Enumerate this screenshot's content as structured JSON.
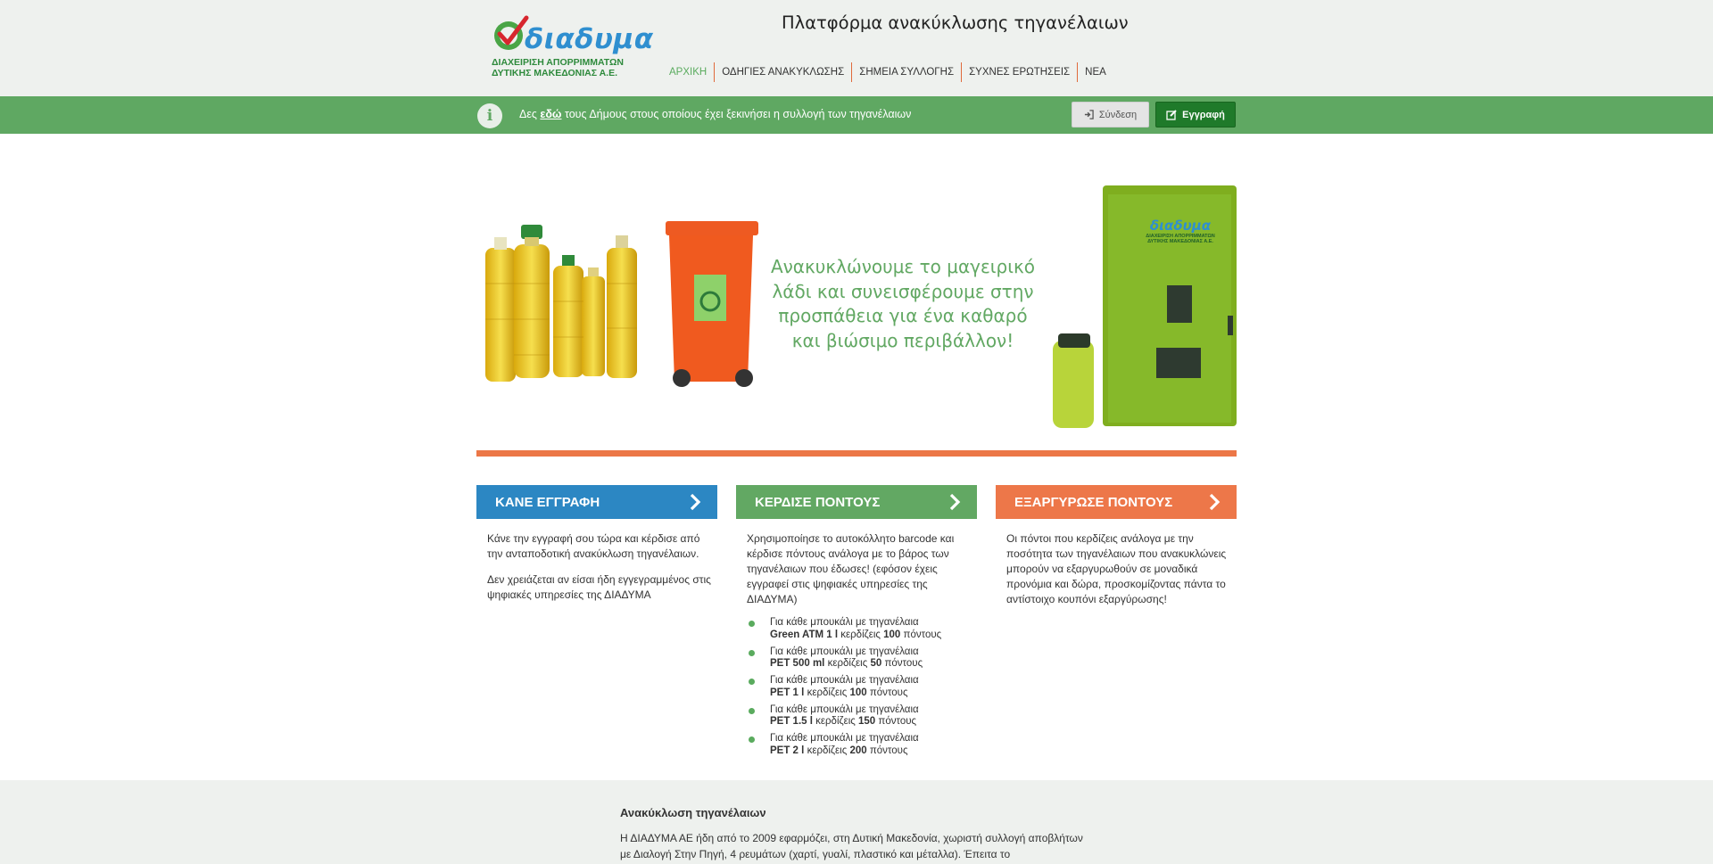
{
  "header": {
    "logo_word": "διαδυμα",
    "logo_line1": "ΔΙΑΧΕΙΡΙΣΗ ΑΠΟΡΡΙΜΜΑΤΩΝ",
    "logo_line2": "ΔΥΤΙΚΗΣ ΜΑΚΕΔΟΝΙΑΣ Α.Ε.",
    "site_title": "Πλατφόρμα ανακύκλωσης τηγανέλαιων",
    "nav": [
      "ΑΡΧΙΚΗ",
      "ΟΔΗΓΙΕΣ ΑΝΑΚΥΚΛΩΣΗΣ",
      "ΣΗΜΕΙΑ ΣΥΛΛΟΓΗΣ",
      "ΣΥΧΝΕΣ ΕΡΩΤΗΣΕΙΣ",
      "ΝΕΑ"
    ]
  },
  "infobar": {
    "text_before": "Δες ",
    "link": "εδώ",
    "text_after": " τους Δήμους στους οποίους έχει ξεκινήσει η συλλογή των τηγανέλαιων",
    "login_label": "Σύνδεση",
    "register_label": "Εγγραφή"
  },
  "hero": {
    "tagline": "Ανακυκλώνουμε το μαγειρικό λάδι και συνεισφέρουμε στην προσπάθεια για ένα καθαρό και βιώσιμο περιβάλλον!",
    "atm_logo_word": "διαδυμα",
    "atm_logo_line1": "ΔΙΑΧΕΙΡΙΣΗ ΑΠΟΡΡΙΜΜΑΤΩΝ",
    "atm_logo_line2": "ΔΥΤΙΚΗΣ ΜΑΚΕΔΟΝΙΑΣ Α.Ε."
  },
  "cards": [
    {
      "title": "ΚΑΝΕ ΕΓΓΡΑΦΗ",
      "p1": "Κάνε την εγγραφή σου τώρα και κέρδισε από την ανταποδοτική ανακύκλωση τηγανέλαιων.",
      "p2": "Δεν χρειάζεται αν είσαι ήδη εγγεγραμμένος στις ψηφιακές υπηρεσίες της ΔΙΑΔΥΜΑ"
    },
    {
      "title": "ΚΕΡΔΙΣΕ ΠΟΝΤΟΥΣ",
      "p1": "Χρησιμοποίησε το αυτοκόλλητο barcode και κέρδισε πόντους ανάλογα με το βάρος των τηγανέλαιων που έδωσες! (εφόσον έχεις εγγραφεί στις ψηφιακές υπηρεσίες της ΔΙΑΔΥΜΑ)",
      "bullets": [
        {
          "prefix": "Για κάθε μπουκάλι με τηγανέλαια",
          "item": "Green ATM 1 l",
          "mid": "κερδίζεις",
          "points": "100",
          "suffix": "πόντους"
        },
        {
          "prefix": "Για κάθε μπουκάλι με τηγανέλαια",
          "item": "PET 500 ml",
          "mid": "κερδίζεις",
          "points": "50",
          "suffix": "πόντους"
        },
        {
          "prefix": "Για κάθε μπουκάλι με τηγανέλαια",
          "item": "PET 1 l",
          "mid": "κερδίζεις",
          "points": "100",
          "suffix": "πόντους"
        },
        {
          "prefix": "Για κάθε μπουκάλι με τηγανέλαια",
          "item": "PET 1.5 l",
          "mid": "κερδίζεις",
          "points": "150",
          "suffix": "πόντους"
        },
        {
          "prefix": "Για κάθε μπουκάλι με τηγανέλαια",
          "item": "PET 2 l",
          "mid": "κερδίζεις",
          "points": "200",
          "suffix": "πόντους"
        }
      ]
    },
    {
      "title": "ΕΞΑΡΓΥΡΩΣΕ ΠΟΝΤΟΥΣ",
      "p1": "Οι πόντοι που κερδίζεις ανάλογα με την ποσότητα των τηγανέλαιων που ανακυκλώνεις μπορούν να εξαργυρωθούν σε μοναδικά προνόμια και δώρα, προσκομίζοντας πάντα το αντίστοιχο κουπόνι εξαργύρωσης!"
    }
  ],
  "bottom": {
    "title": "Ανακύκλωση τηγανέλαιων",
    "text": "Η ΔΙΑΔΥΜΑ ΑΕ ήδη από το 2009 εφαρμόζει, στη Δυτική Μακεδονία, χωριστή συλλογή αποβλήτων με Διαλογή Στην Πηγή, 4 ρευμάτων (χαρτί, γυαλί, πλαστικό και μέταλλα). Έπειτα το"
  },
  "colors": {
    "green": "#62a863",
    "dark_green": "#1f7a2a",
    "blue": "#2c87c3",
    "orange": "#ed7749",
    "header_bg": "#eef1ee"
  }
}
